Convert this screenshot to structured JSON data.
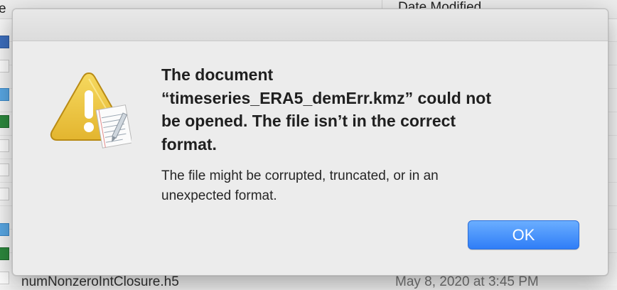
{
  "background_window": {
    "first_column_header_fragment": "e",
    "date_column_header": "Date Modified",
    "footer_file_name": "numNonzeroIntClosure.h5",
    "footer_date": "May 8, 2020 at 3:45 PM"
  },
  "dialog": {
    "title": "The document\n“timeseries_ERA5_demErr.kmz” could not\nbe opened. The file isn’t in the correct\nformat.",
    "message": "The file might be corrupted, truncated, or in an\nunexpected format.",
    "ok_label": "OK",
    "icon": "caution-with-document-icon",
    "accent_color": "#2f7df7"
  }
}
